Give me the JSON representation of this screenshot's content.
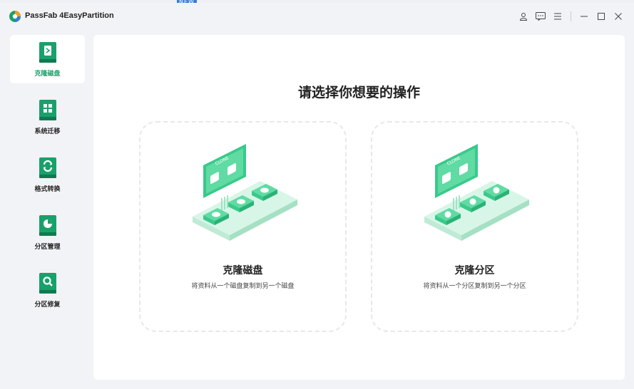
{
  "app": {
    "title": "PassFab 4EasyPartition"
  },
  "titlebar": {
    "icons": [
      "user-icon",
      "feedback-icon",
      "menu-icon",
      "minimize-icon",
      "maximize-icon",
      "close-icon"
    ]
  },
  "sidebar": {
    "items": [
      {
        "label": "克隆磁盘",
        "icon": "clone-disk-icon",
        "active": true
      },
      {
        "label": "系统迁移",
        "icon": "system-migrate-icon",
        "active": false
      },
      {
        "label": "格式转换",
        "icon": "format-convert-icon",
        "active": false
      },
      {
        "label": "分区管理",
        "icon": "partition-manage-icon",
        "active": false
      },
      {
        "label": "分区修复",
        "icon": "partition-repair-icon",
        "active": false
      }
    ]
  },
  "main": {
    "heading": "请选择你想要的操作",
    "cards": [
      {
        "title": "克隆磁盘",
        "desc": "将资料从一个磁盘复制到另一个磁盘",
        "illustration_text": "CLONE"
      },
      {
        "title": "克隆分区",
        "desc": "将资料从一个分区复制到另一个分区",
        "illustration_text": "CLONE"
      }
    ]
  },
  "colors": {
    "accent": "#1aa06a",
    "accent_light": "#7fe2b5",
    "panel": "#ffffff"
  }
}
